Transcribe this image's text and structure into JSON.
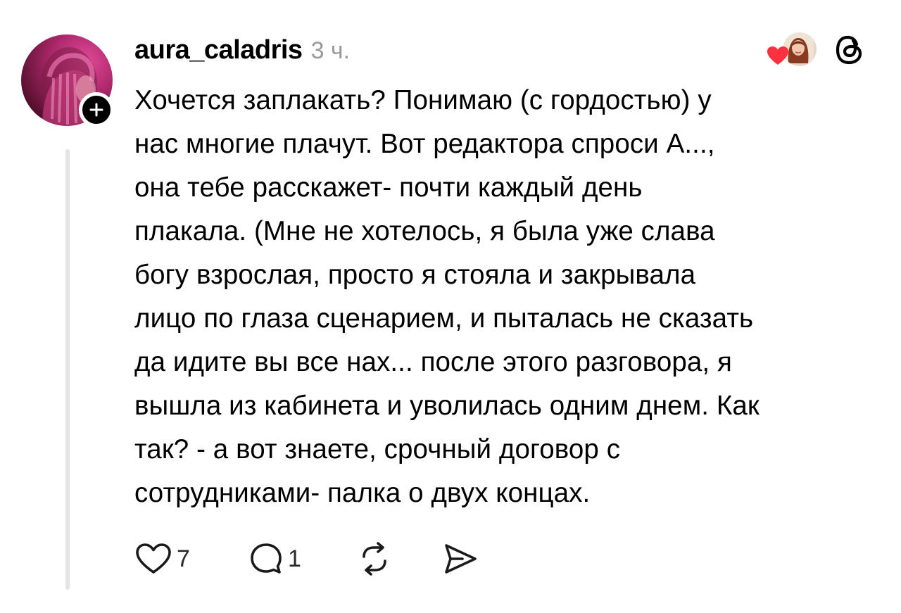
{
  "post": {
    "username": "aura_caladris",
    "time_ago": "3 ч.",
    "body_lines": [
      "Хочется заплакать? Понимаю (с гордостью) у",
      "нас многие плачут.  Вот редактора спроси А...,",
      "она тебе расскажет- почти каждый день",
      "плакала. (Мне не хотелось, я была уже слава",
      "богу взрослая, просто я стояла и закрывала",
      "лицо по глаза сценарием, и пыталась не сказать",
      "да идите вы все нах... после этого разговора, я",
      "вышла из кабинета и уволилась одним днем. Как",
      "так? - а вот знаете, срочный договор с",
      "сотрудниками- палка о двух концах."
    ],
    "like_count": "7",
    "reply_count": "1"
  },
  "icons": {
    "follow": "plus-icon",
    "liked_by": "heart-icon",
    "brand": "threads-logo-icon",
    "like": "heart-outline-icon",
    "reply": "comment-bubble-icon",
    "repost": "repost-icon",
    "share": "send-icon"
  },
  "colors": {
    "text": "#000000",
    "muted": "#9a9a9a",
    "heart": "#ff3040",
    "thread_line": "#e3e3e3"
  }
}
